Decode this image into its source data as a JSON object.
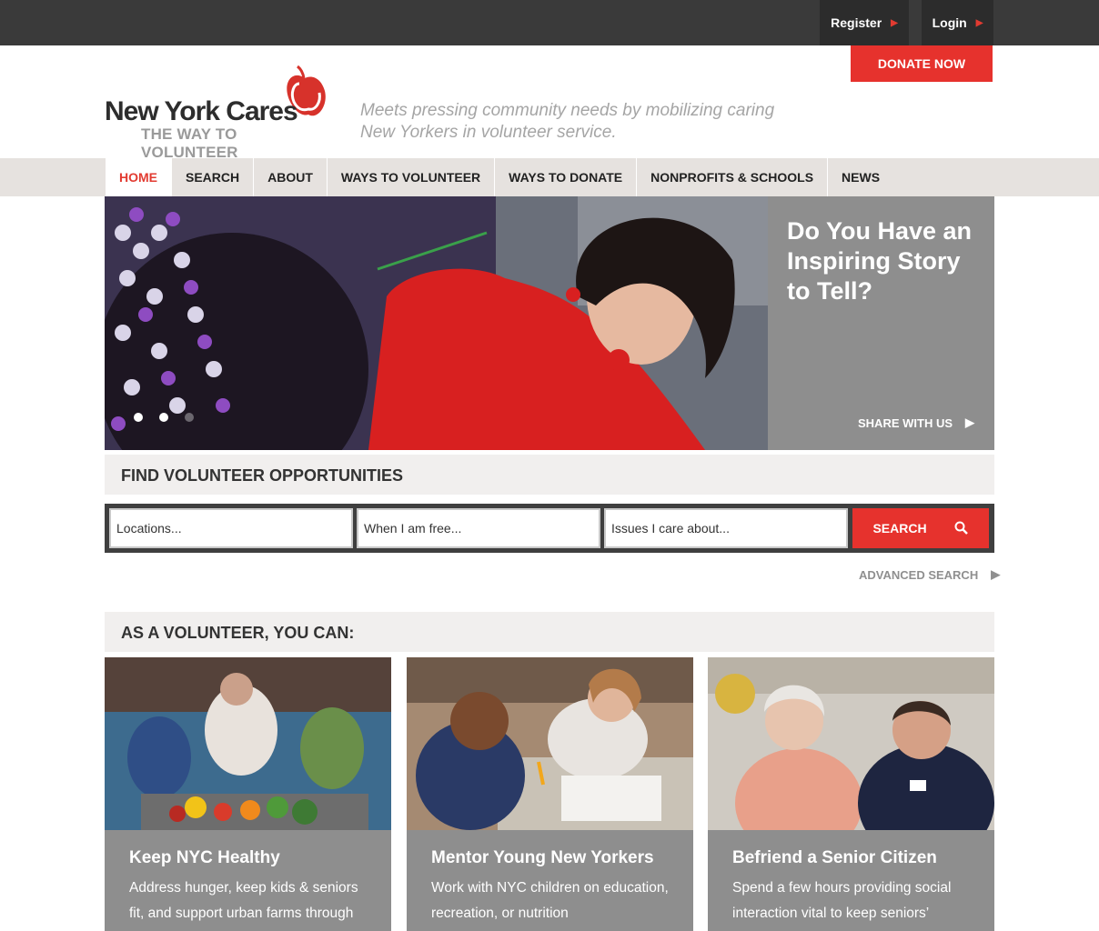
{
  "topbar": {
    "register": "Register",
    "login": "Login"
  },
  "donate_label": "DONATE NOW",
  "logo": {
    "name": "New York Cares",
    "tagline": "THE WAY TO VOLUNTEER"
  },
  "site_tagline": "Meets pressing community needs by mobilizing caring New Yorkers in volunteer service.",
  "nav": [
    {
      "label": "HOME"
    },
    {
      "label": "SEARCH"
    },
    {
      "label": "ABOUT"
    },
    {
      "label": "WAYS TO VOLUNTEER"
    },
    {
      "label": "WAYS TO DONATE"
    },
    {
      "label": "NONPROFITS & SCHOOLS"
    },
    {
      "label": "NEWS"
    }
  ],
  "hero": {
    "title": "Do You Have an Inspiring Story to Tell?",
    "cta": "SHARE WITH US"
  },
  "find": {
    "heading": "FIND VOLUNTEER OPPORTUNITIES",
    "locations": "Locations...",
    "when": "When I am free...",
    "issues": "Issues I care about...",
    "search_label": "SEARCH",
    "advanced": "ADVANCED SEARCH"
  },
  "volunteer": {
    "heading": "AS A VOLUNTEER, YOU CAN:",
    "cards": [
      {
        "title": "Keep NYC Healthy",
        "text": "Address hunger, keep kids & seniors fit, and support urban farms through"
      },
      {
        "title": "Mentor Young New Yorkers",
        "text": "Work with NYC children on education, recreation, or nutrition"
      },
      {
        "title": "Befriend a Senior Citizen",
        "text": "Spend a few hours providing social interaction vital to keep seniors’"
      }
    ]
  },
  "colors": {
    "accent": "#e6322d",
    "topbar": "#3a3a3a",
    "panel": "#8e8e8e",
    "nav_bg": "#e6e2df"
  }
}
